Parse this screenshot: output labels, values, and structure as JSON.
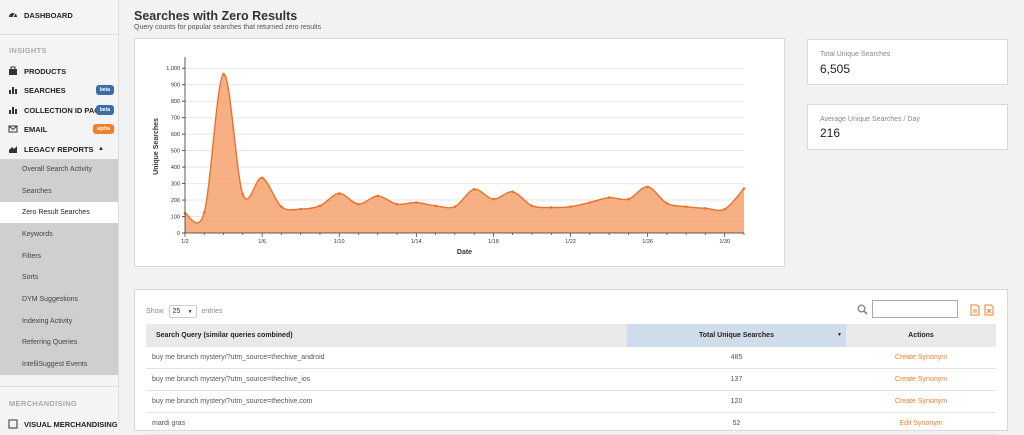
{
  "sidebar": {
    "dashboard": "DASHBOARD",
    "insights_heading": "INSIGHTS",
    "products": "PRODUCTS",
    "searches": "SEARCHES",
    "searches_badge": "beta",
    "collection_id_pages": "COLLECTION ID PAGES",
    "collection_badge": "beta",
    "email": "EMAIL",
    "email_badge": "alpha",
    "legacy_reports": "LEGACY REPORTS",
    "legacy_items": [
      "Overall Search Activity",
      "Searches",
      "Zero Result Searches",
      "Keywords",
      "Filters",
      "Sorts",
      "DYM Suggestions",
      "Indexing Activity",
      "Referring Queries",
      "IntelliSuggest Events"
    ],
    "merchandising_heading": "MERCHANDISING",
    "visual_merchandising": "VISUAL MERCHANDISING"
  },
  "header": {
    "title": "Searches with Zero Results",
    "subtitle": "Query counts for popular searches that returned zero results"
  },
  "stats": {
    "total_label": "Total Unique Searches",
    "total_value": "6,505",
    "avg_label": "Average Unique Searches / Day",
    "avg_value": "216"
  },
  "chart_data": {
    "type": "area",
    "xlabel": "Date",
    "ylabel": "Unique Searches",
    "ylim": [
      0,
      1050
    ],
    "yticks": [
      0,
      100,
      200,
      300,
      400,
      500,
      600,
      700,
      800,
      900,
      1000
    ],
    "ytick_labels": [
      "0",
      "100",
      "200",
      "300",
      "400",
      "500",
      "600",
      "700",
      "800",
      "900",
      "1,000"
    ],
    "x": [
      "1/2",
      "1/3",
      "1/4",
      "1/5",
      "1/6",
      "1/7",
      "1/8",
      "1/9",
      "1/10",
      "1/11",
      "1/12",
      "1/13",
      "1/14",
      "1/15",
      "1/16",
      "1/17",
      "1/18",
      "1/19",
      "1/20",
      "1/21",
      "1/22",
      "1/23",
      "1/24",
      "1/25",
      "1/26",
      "1/27",
      "1/28",
      "1/29",
      "1/30",
      "1/31"
    ],
    "values": [
      120,
      125,
      965,
      235,
      335,
      160,
      145,
      165,
      240,
      175,
      225,
      175,
      185,
      165,
      160,
      265,
      205,
      250,
      165,
      155,
      160,
      185,
      215,
      205,
      280,
      180,
      160,
      150,
      145,
      270
    ],
    "xtick_labels": [
      "1/2",
      "1/6",
      "1/10",
      "1/14",
      "1/18",
      "1/22",
      "1/26",
      "1/30"
    ],
    "colors": {
      "fill": "#f5a26e",
      "line": "#e9722b"
    },
    "grid": true
  },
  "table": {
    "show_label": "Show",
    "show_value": "25",
    "entries_label": "entries",
    "headers": [
      "Search Query (similar queries combined)",
      "Total Unique Searches",
      "Actions"
    ],
    "rows": [
      {
        "query": "buy me brunch mystery/?utm_source=thechive_android",
        "count": "485",
        "action": "Create Synonym"
      },
      {
        "query": "buy me brunch mystery/?utm_source=thechive_ios",
        "count": "137",
        "action": "Create Synonym"
      },
      {
        "query": "buy me brunch mystery/?utm_source=thechive.com",
        "count": "120",
        "action": "Create Synonym"
      },
      {
        "query": "mardi gras",
        "count": "52",
        "action": "Edit Synonym"
      }
    ]
  }
}
